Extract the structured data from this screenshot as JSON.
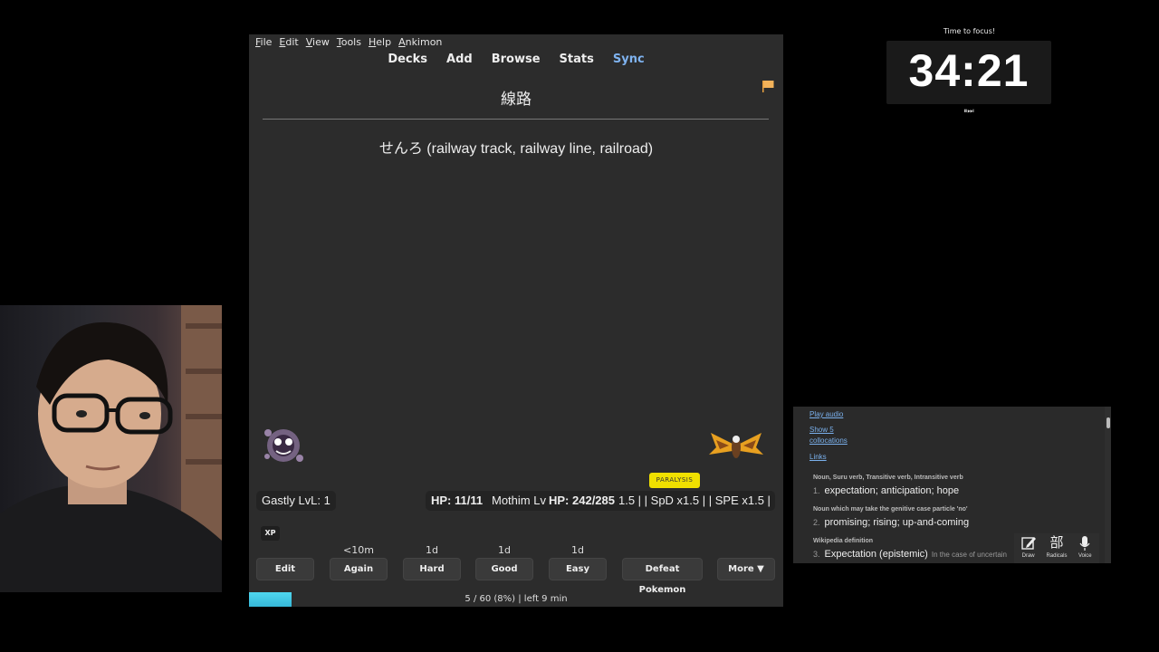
{
  "menu": [
    "File",
    "Edit",
    "View",
    "Tools",
    "Help",
    "Ankimon"
  ],
  "toolbar": {
    "decks": "Decks",
    "add": "Add",
    "browse": "Browse",
    "stats": "Stats",
    "sync": "Sync"
  },
  "card": {
    "front": "線路",
    "back": "せんろ (railway track, railway line, railroad)"
  },
  "battle": {
    "status": "PARALYSIS",
    "player": "Gastly LvL: 1",
    "enemy_hp": "HP: 11/11",
    "enemy_name": "Mothim Lv",
    "enemy_hp2": "HP: 242/285",
    "enemy_stats": "1.5 | | SpD x1.5 | | SPE x1.5 |",
    "xp": "XP"
  },
  "answers": {
    "again_ivl": "<10m",
    "hard_ivl": "1d",
    "good_ivl": "1d",
    "easy_ivl": "1d",
    "edit": "Edit",
    "again": "Again",
    "hard": "Hard",
    "good": "Good",
    "easy": "Easy",
    "defeat": "Defeat Pokemon",
    "more": "More ▼"
  },
  "progress": {
    "text": "5 / 60 (8%) | left 9 min",
    "fraction": 0.08
  },
  "timer": {
    "label": "Time to focus!",
    "time": "34:21",
    "controls": "⏸⏭"
  },
  "dictionary": {
    "play_audio": "Play audio",
    "show": "Show 5",
    "collocations": "collocations",
    "links": "Links",
    "pos1": "Noun, Suru verb, Transitive verb, Intransitive verb",
    "def1_num": "1.",
    "def1": "expectation; anticipation; hope",
    "pos2": "Noun which may take the genitive case particle 'no'",
    "def2_num": "2.",
    "def2": "promising; rising; up-and-coming",
    "pos3": "Wikipedia definition",
    "def3_num": "3.",
    "def3": "Expectation (epistemic)",
    "def3_extra": "In the case of uncertain",
    "tool_draw": "Draw",
    "tool_radicals": "Radicals",
    "tool_radicals_glyph": "部",
    "tool_voice": "Voice"
  },
  "colors": {
    "accent": "#7fb3f0",
    "status": "#f0e000",
    "progress": "#4fd6ee"
  }
}
